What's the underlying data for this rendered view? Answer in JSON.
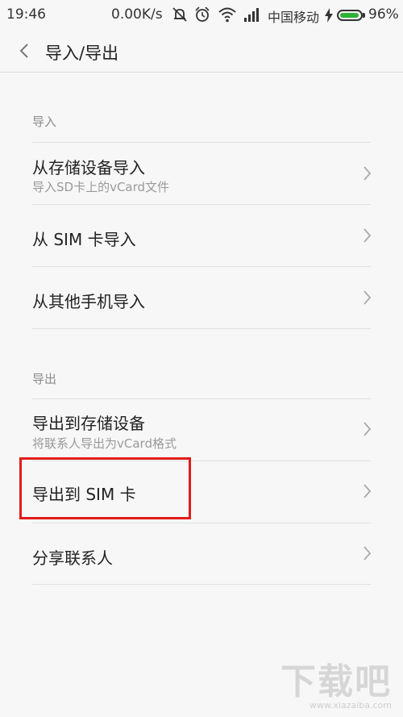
{
  "status_bar": {
    "time": "19:46",
    "net_speed": "0.00K/s",
    "carrier": "中国移动",
    "battery_percent": "96%",
    "battery_level": 0.96,
    "icons": [
      "mute-icon",
      "alarm-icon",
      "wifi-icon",
      "signal-icon",
      "charging-icon",
      "battery-icon"
    ]
  },
  "header": {
    "title": "导入/导出",
    "back_icon": "chevron-left-icon"
  },
  "import_section": {
    "label": "导入",
    "items": [
      {
        "title": "从存储设备导入",
        "subtitle": "导入SD卡上的vCard文件"
      },
      {
        "title": "从 SIM 卡导入"
      },
      {
        "title": "从其他手机导入"
      }
    ]
  },
  "export_section": {
    "label": "导出",
    "items": [
      {
        "title": "导出到存储设备",
        "subtitle": "将联系人导出为vCard格式"
      },
      {
        "title": "导出到 SIM 卡"
      },
      {
        "title": "分享联系人"
      }
    ]
  },
  "highlight_color": "#e21b1b",
  "watermark": {
    "logo": "下载吧",
    "url": "www.xiazaiba.com"
  }
}
